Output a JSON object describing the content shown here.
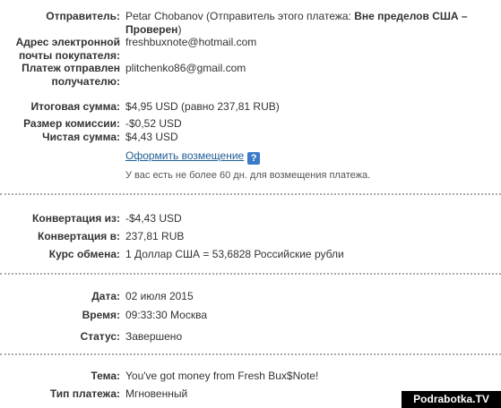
{
  "sender": {
    "label": "Отправитель:",
    "name": "Petar Chobanov (Отправитель этого платежа: ",
    "status": "Вне пределов США –",
    "status_cont": "Проверен",
    "close_paren": ")"
  },
  "buyer_email": {
    "label_line1": "Адрес электронной",
    "label_line2": "почты покупателя:",
    "value": "freshbuxnote@hotmail.com"
  },
  "recipient": {
    "label_line1": "Платеж отправлен",
    "label_line2": "получателю:",
    "value": "plitchenko86@gmail.com"
  },
  "amounts": {
    "total_label": "Итоговая сумма:",
    "total_value": "$4,95 USD (равно 237,81 RUB)",
    "fee_label": "Размер комиссии:",
    "fee_value": "-$0,52 USD",
    "net_label": "Чистая сумма:",
    "net_value": "$4,43 USD"
  },
  "refund": {
    "link_label": "Оформить возмещение",
    "help_icon": "?",
    "note": "У вас есть не более 60 дн. для возмещения платежа."
  },
  "conversion": {
    "from_label": "Конвертация из:",
    "from_value": "-$4,43 USD",
    "to_label": "Конвертация в:",
    "to_value": "237,81 RUB",
    "rate_label": "Курс обмена:",
    "rate_value": "1 Доллар США = 53,6828 Российские рубли"
  },
  "details": {
    "date_label": "Дата:",
    "date_value": "02 июля 2015",
    "time_label": "Время:",
    "time_value": "09:33:30 Москва",
    "status_label": "Статус:",
    "status_value": "Завершено"
  },
  "subject": {
    "label": "Тема:",
    "value": "You've got money from Fresh Bux$Note!"
  },
  "payment_type": {
    "label": "Тип платежа:",
    "value": "Мгновенный"
  },
  "watermark": "Podrabotka.TV"
}
